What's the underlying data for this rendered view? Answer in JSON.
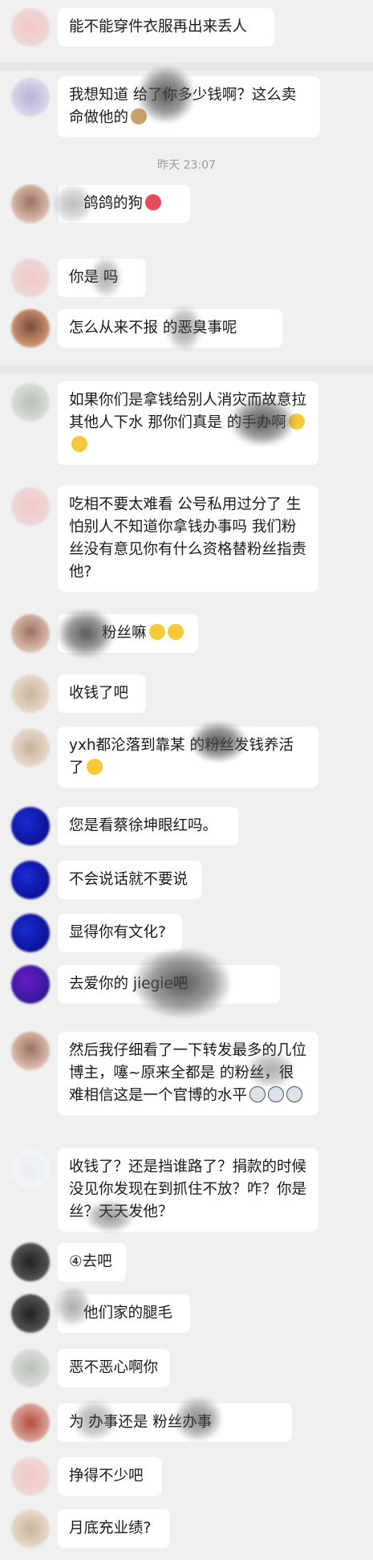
{
  "timestamp": "昨天 23:07",
  "messages": [
    {
      "text": "能不能穿件衣服再出来丢人",
      "emoji": []
    },
    {
      "text": "我想知道 给了你多少钱啊？这么卖命做他的",
      "emoji": [
        "dog-face-icon"
      ]
    },
    {
      "text": "鸽鸽的狗",
      "emoji": [
        "heart-eyes-icon"
      ]
    },
    {
      "text": "你是 吗",
      "emoji": []
    },
    {
      "text": "怎么从来不报 的恶臭事呢",
      "emoji": []
    },
    {
      "text": "如果你们是拿钱给别人消灾而故意拉其他人下水 那你们真是 的手办啊",
      "emoji": [
        "hug-face-icon",
        "shy-face-icon"
      ]
    },
    {
      "text": "吃相不要太难看 公号私用过分了 生怕别人不知道你拿钱办事吗 我们粉丝没有意见你有什么资格替粉丝指责他?",
      "emoji": []
    },
    {
      "text": "粉丝嘛",
      "emoji": [
        "pleading-face-icon",
        "pleading-face-icon"
      ]
    },
    {
      "text": "收钱了吧",
      "emoji": []
    },
    {
      "text": "yxh都沦落到靠某 的粉丝发钱养活了",
      "emoji": [
        "smile-face-icon"
      ]
    },
    {
      "text": "您是看蔡徐坤眼红吗。",
      "emoji": []
    },
    {
      "text": "不会说话就不要说",
      "emoji": []
    },
    {
      "text": "显得你有文化?",
      "emoji": []
    },
    {
      "text": "去爱你的 jiegie吧",
      "emoji": []
    },
    {
      "text": "然后我仔细看了一下转发最多的几位博主，噻~原来全都是 的粉丝，很难相信这是一个官博的水平",
      "emoji": [
        "husky-face-icon",
        "husky-face-icon",
        "husky-face-icon"
      ]
    },
    {
      "text": "收钱了？还是挡谁路了？捐款的时候没见你发现在到抓住不放？咋？你是 丝？天天发他？",
      "emoji": []
    },
    {
      "text": "④去吧",
      "emoji": []
    },
    {
      "text": "他们家的腿毛",
      "emoji": []
    },
    {
      "text": "恶不恶心啊你",
      "emoji": []
    },
    {
      "text": "为 办事还是 粉丝办事",
      "emoji": []
    },
    {
      "text": "挣得不少吧",
      "emoji": []
    },
    {
      "text": "月底充业绩?",
      "emoji": []
    }
  ]
}
